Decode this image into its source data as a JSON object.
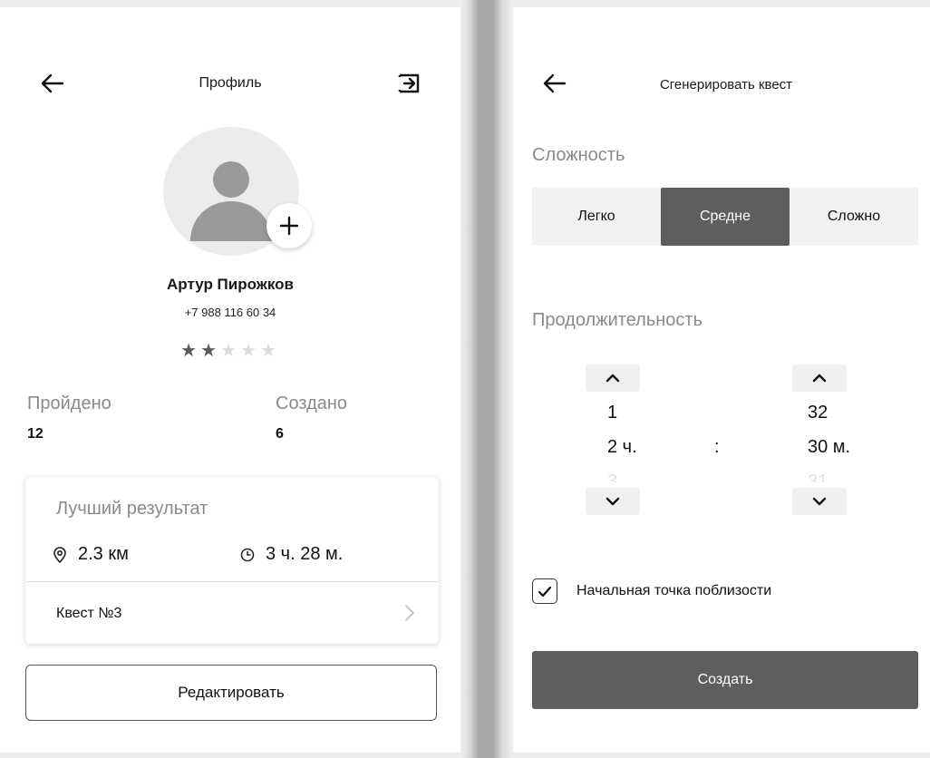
{
  "profile": {
    "title": "Профиль",
    "user": {
      "name": "Артур Пирожков",
      "phone": "+7 988 116 60 34",
      "rating": 2,
      "rating_max": 5
    },
    "stats": {
      "completed_label": "Пройдено",
      "completed_value": "12",
      "created_label": "Создано",
      "created_value": "6"
    },
    "best_result": {
      "title": "Лучший результат",
      "distance": "2.3 км",
      "time": "3 ч. 28 м.",
      "quest_label": "Квест №3"
    },
    "edit_button": "Редактировать",
    "icons": {
      "back": "arrow-left-icon",
      "logout": "logout-icon",
      "add_photo": "plus-icon",
      "location": "location-pin-icon",
      "clock": "clock-icon",
      "chevron": "chevron-right-icon"
    }
  },
  "generate": {
    "title": "Сгенерировать квест",
    "difficulty_label": "Сложность",
    "difficulty_options": [
      "Легко",
      "Средне",
      "Сложно"
    ],
    "difficulty_selected": "Средне",
    "duration_label": "Продолжительность",
    "hours": {
      "prev": "1",
      "current": "2 ч.",
      "next": "3"
    },
    "minutes": {
      "prev": "32",
      "current": "30 м.",
      "next": "31"
    },
    "separator": ":",
    "nearby_label": "Начальная точка поблизости",
    "nearby_checked": true,
    "create_button": "Создать"
  },
  "colors": {
    "accent": "#5e5e5e",
    "muted_text": "#8a8a8a",
    "segment_bg": "#f2f2f2"
  }
}
